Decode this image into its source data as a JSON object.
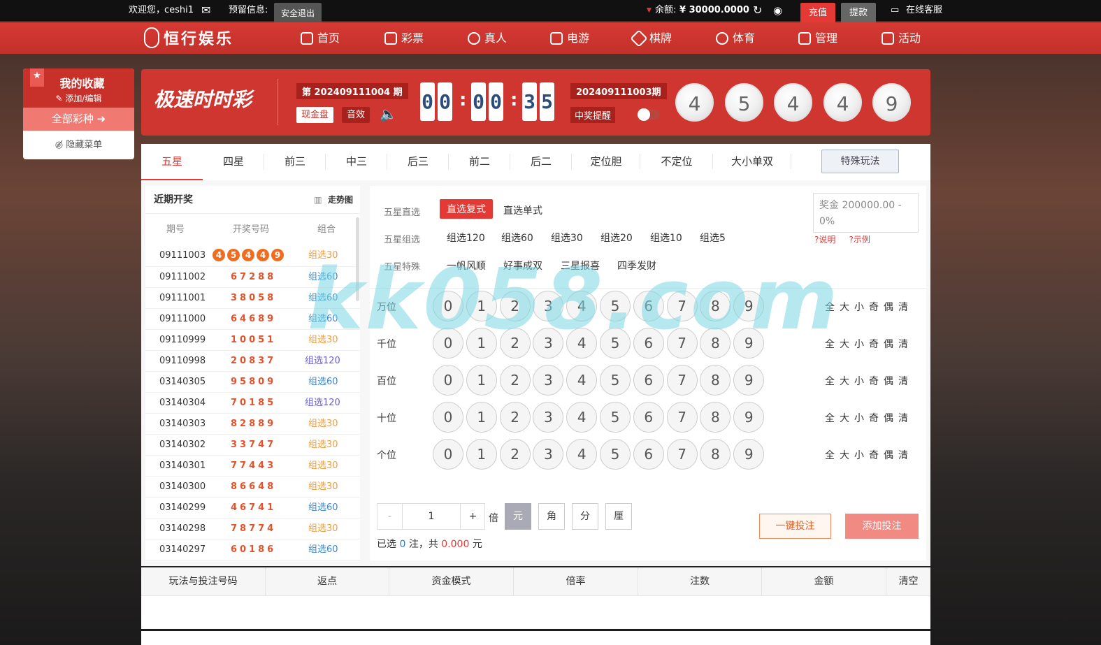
{
  "topbar": {
    "welcome": "欢迎您，",
    "user": "ceshi1",
    "reserve": "预留信息:",
    "logout": "安全退出",
    "balance_label": "余额:",
    "balance": "¥ 30000.0000",
    "recharge": "充值",
    "withdraw": "提款",
    "service": "在线客服"
  },
  "nav": {
    "brand": "恒行娱乐",
    "items": [
      "首页",
      "彩票",
      "真人",
      "电游",
      "棋牌",
      "体育",
      "管理",
      "活动"
    ]
  },
  "fav": {
    "title": "我的收藏",
    "edit": "添加/编辑",
    "all": "全部彩种",
    "hide": "隐藏菜单"
  },
  "lottery": {
    "name": "极速时时彩",
    "issue": "第 202409111004 期",
    "cash": "现金盘",
    "sound": "音效",
    "countdown": [
      "0",
      "0",
      "0",
      "0",
      "3",
      "5"
    ],
    "prev_issue": "202409111003期",
    "remind": "中奖提醒",
    "balls": [
      "4",
      "5",
      "4",
      "4",
      "9"
    ]
  },
  "tabs": [
    "五星",
    "四星",
    "前三",
    "中三",
    "后三",
    "前二",
    "后二",
    "定位胆",
    "不定位",
    "大小单双"
  ],
  "special": "特殊玩法",
  "recent": {
    "title": "近期开奖",
    "trend": "走势图",
    "cols": [
      "期号",
      "开奖号码",
      "组合"
    ],
    "rows": [
      {
        "id": "09111003",
        "num": "45449",
        "grp": "组选30",
        "c": "g30"
      },
      {
        "id": "09111002",
        "num": "67288",
        "grp": "组选60",
        "c": "g60"
      },
      {
        "id": "09111001",
        "num": "38058",
        "grp": "组选60",
        "c": "g60"
      },
      {
        "id": "09111000",
        "num": "64689",
        "grp": "组选60",
        "c": "g60"
      },
      {
        "id": "09110999",
        "num": "10051",
        "grp": "组选30",
        "c": "g30"
      },
      {
        "id": "09110998",
        "num": "20837",
        "grp": "组选120",
        "c": "g120"
      },
      {
        "id": "03140305",
        "num": "95809",
        "grp": "组选60",
        "c": "g60"
      },
      {
        "id": "03140304",
        "num": "70185",
        "grp": "组选120",
        "c": "g120"
      },
      {
        "id": "03140303",
        "num": "82889",
        "grp": "组选30",
        "c": "g30"
      },
      {
        "id": "03140302",
        "num": "33747",
        "grp": "组选30",
        "c": "g30"
      },
      {
        "id": "03140301",
        "num": "77443",
        "grp": "组选30",
        "c": "g30"
      },
      {
        "id": "03140300",
        "num": "86648",
        "grp": "组选30",
        "c": "g30"
      },
      {
        "id": "03140299",
        "num": "46741",
        "grp": "组选60",
        "c": "g60"
      },
      {
        "id": "03140298",
        "num": "78774",
        "grp": "组选30",
        "c": "g30"
      },
      {
        "id": "03140297",
        "num": "60186",
        "grp": "组选60",
        "c": "g60"
      }
    ]
  },
  "play": {
    "l1": "五星直选",
    "o1": [
      "直选复式",
      "直选单式"
    ],
    "l2": "五星组选",
    "o2": [
      "组选120",
      "组选60",
      "组选30",
      "组选20",
      "组选10",
      "组选5"
    ],
    "l3": "五星特殊",
    "o3": [
      "一帆风顺",
      "好事成双",
      "三星报喜",
      "四季发财"
    ],
    "prize": "奖金 200000.00 - 0%",
    "explain": "?说明",
    "example": "?示例",
    "positions": [
      "万位",
      "千位",
      "百位",
      "十位",
      "个位"
    ],
    "digits": [
      "0",
      "1",
      "2",
      "3",
      "4",
      "5",
      "6",
      "7",
      "8",
      "9"
    ],
    "quick": "全大小奇偶清",
    "minus": "-",
    "mult": "1",
    "plus": "+",
    "bei": "倍",
    "units": [
      "元",
      "角",
      "分",
      "厘"
    ],
    "sum_pre": "已选 ",
    "sum_n": "0",
    "sum_mid": " 注，共 ",
    "sum_amt": "0.000",
    "sum_post": " 元",
    "onekey": "一键投注",
    "add": "添加投注"
  },
  "bets": {
    "cols": [
      "玩法与投注号码",
      "返点",
      "资金模式",
      "倍率",
      "注数",
      "金额",
      "清空"
    ]
  },
  "watermark": "kk058.com"
}
